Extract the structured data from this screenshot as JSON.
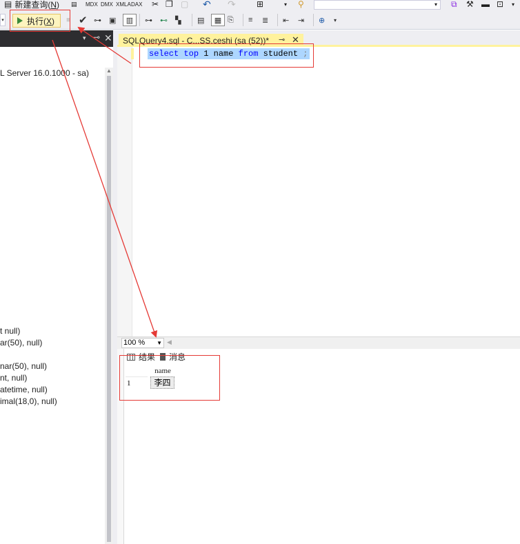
{
  "menu": {
    "new_query_label": "新建查询(",
    "new_query_key": "N",
    "new_query_suffix": ")",
    "icons": [
      "new-query-icon",
      "mdx-query-icon",
      "dmx-query-icon",
      "xmla-query-icon",
      "dax-query-icon",
      "cut-icon",
      "copy-icon",
      "paste-icon",
      "undo-icon",
      "redo-icon",
      "save-icon",
      "dropdown-icon",
      "wrench-icon",
      "toolbox-icon",
      "terminal-icon"
    ]
  },
  "toolbar": {
    "execute_label": "执行(",
    "execute_key": "X",
    "execute_suffix": ")"
  },
  "object_explorer": {
    "server_label": "L Server 16.0.1000 - sa)",
    "columns": [
      "t null)",
      "ar(50), null)",
      "nar(50), null)",
      "nt, null)",
      "atetime, null)",
      "imal(18,0), null)"
    ]
  },
  "editor": {
    "tab_title": "SQLQuery4.sql - C...SS.ceshi (sa (52))*",
    "pin_icon": "⊸",
    "close_icon": "✕",
    "sql": {
      "kw1": "select",
      "kw2": "top",
      "num": "1",
      "col": "name",
      "kw3": "from",
      "table": "student",
      "semi": ";"
    }
  },
  "zoom": {
    "value": "100 %"
  },
  "results": {
    "tab_results": "结果",
    "tab_messages": "消息",
    "header": "name",
    "row_number": "1",
    "cell": "李四"
  },
  "colors": {
    "annotation": "#e53935",
    "tab_active": "#fff29d",
    "selection": "#add6ff",
    "keyword": "#0000ff"
  }
}
